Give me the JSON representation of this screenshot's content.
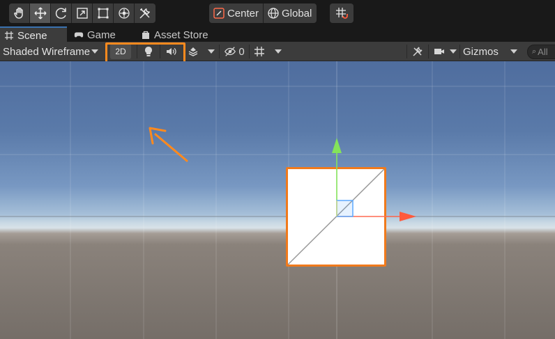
{
  "toolbar": {
    "tools": [
      {
        "name": "hand-tool",
        "icon": "hand-icon",
        "active": false
      },
      {
        "name": "move-tool",
        "icon": "move-icon",
        "active": true
      },
      {
        "name": "rotate-tool",
        "icon": "rotate-icon",
        "active": false
      },
      {
        "name": "scale-tool",
        "icon": "scale-icon",
        "active": false
      },
      {
        "name": "rect-tool",
        "icon": "rect-icon",
        "active": false
      },
      {
        "name": "transform-tool",
        "icon": "transform-icon",
        "active": false
      },
      {
        "name": "custom-tool",
        "icon": "tools-icon",
        "active": false
      }
    ],
    "pivot_mode": "Center",
    "pivot_rotation": "Global"
  },
  "tabs": [
    {
      "label": "Scene",
      "icon": "grid-icon",
      "active": true
    },
    {
      "label": "Game",
      "icon": "gamepad-icon",
      "active": false
    },
    {
      "label": "Asset Store",
      "icon": "bag-icon",
      "active": false
    }
  ],
  "scene_toolbar": {
    "shading_mode": "Shaded Wireframe",
    "toggle_2d_label": "2D",
    "hidden_count": "0",
    "gizmos_label": "Gizmos",
    "search_placeholder": "All"
  },
  "colors": {
    "highlight": "#ff8a1e",
    "selection_outline": "#f07a1c",
    "axis_x": "#ff5a3c",
    "axis_y": "#84e35a",
    "axis_z": "#5aa8ff"
  }
}
